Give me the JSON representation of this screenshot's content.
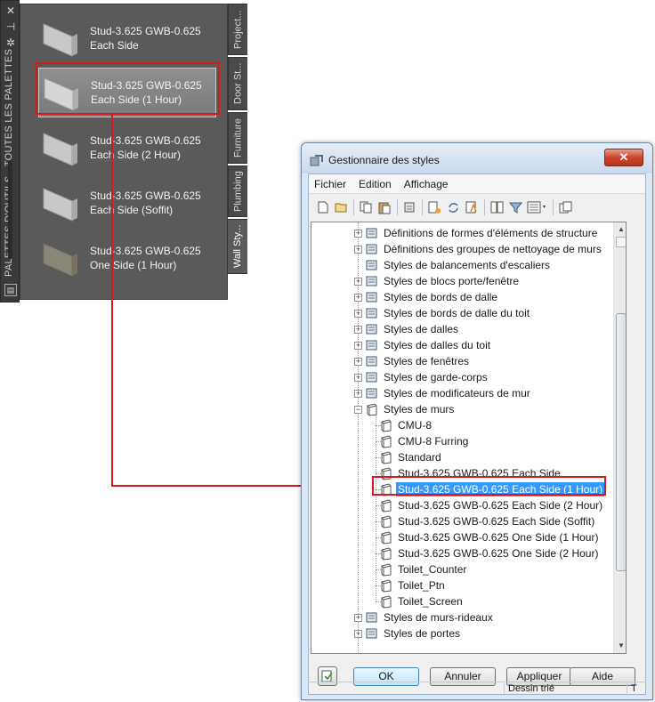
{
  "palette": {
    "vertical_title": "PALETTES D'OUTILS - TOUTES LES PALETTES",
    "tabs": [
      "Project...",
      "Door St...",
      "Furniture",
      "Plumbing",
      "Wall Sty..."
    ],
    "active_tab_index": 4,
    "tools": [
      {
        "label": "Stud-3.625 GWB-0.625\nEach Side"
      },
      {
        "label": "Stud-3.625 GWB-0.625\nEach Side (1 Hour)"
      },
      {
        "label": "Stud-3.625 GWB-0.625\nEach Side (2 Hour)"
      },
      {
        "label": "Stud-3.625 GWB-0.625\nEach Side (Soffit)"
      },
      {
        "label": "Stud-3.625 GWB-0.625\nOne Side (1 Hour)"
      }
    ],
    "selected_tool_index": 1
  },
  "dialog": {
    "title": "Gestionnaire des styles",
    "close_glyph": "✕",
    "menu": [
      "Fichier",
      "Edition",
      "Affichage"
    ],
    "toolbar_icons": [
      "new-icon",
      "open-icon",
      "copy-icon",
      "paste-icon",
      "purge-icon",
      "edit-style-icon",
      "sync-icon",
      "inspect-icon",
      "compare-icon",
      "filter-icon",
      "view-mode-icon",
      "export-icon"
    ],
    "tree": {
      "items": [
        {
          "label": "Définitions de formes d'éléments de structure",
          "level": 0,
          "expander": "+",
          "icon": "structure-shape-icon"
        },
        {
          "label": "Définitions des groupes de nettoyage de murs",
          "level": 0,
          "expander": "+",
          "icon": "cleanup-group-icon"
        },
        {
          "label": "Styles de balancements d'escaliers",
          "level": 0,
          "expander": "",
          "icon": "stair-winder-icon"
        },
        {
          "label": "Styles de blocs porte/fenêtre",
          "level": 0,
          "expander": "+",
          "icon": "door-window-assembly-icon"
        },
        {
          "label": "Styles de bords de dalle",
          "level": 0,
          "expander": "+",
          "icon": "slab-edge-icon"
        },
        {
          "label": "Styles de bords de dalle du toit",
          "level": 0,
          "expander": "+",
          "icon": "roof-slab-edge-icon"
        },
        {
          "label": "Styles de dalles",
          "level": 0,
          "expander": "+",
          "icon": "slab-icon"
        },
        {
          "label": "Styles de dalles du toit",
          "level": 0,
          "expander": "+",
          "icon": "roof-slab-icon"
        },
        {
          "label": "Styles de fenêtres",
          "level": 0,
          "expander": "+",
          "icon": "window-icon"
        },
        {
          "label": "Styles de garde-corps",
          "level": 0,
          "expander": "+",
          "icon": "railing-icon"
        },
        {
          "label": "Styles de modificateurs de mur",
          "level": 0,
          "expander": "+",
          "icon": "wall-modifier-icon"
        },
        {
          "label": "Styles de murs",
          "level": 0,
          "expander": "−",
          "icon": "wall-style-icon"
        },
        {
          "label": "CMU-8",
          "level": 1,
          "expander": "",
          "icon": "wall-style-icon"
        },
        {
          "label": "CMU-8 Furring",
          "level": 1,
          "expander": "",
          "icon": "wall-style-icon"
        },
        {
          "label": "Standard",
          "level": 1,
          "expander": "",
          "icon": "wall-style-icon"
        },
        {
          "label": "Stud-3.625 GWB-0.625 Each Side",
          "level": 1,
          "expander": "",
          "icon": "wall-style-icon"
        },
        {
          "label": "Stud-3.625 GWB-0.625 Each Side (1 Hour)",
          "level": 1,
          "expander": "",
          "icon": "wall-style-icon",
          "selected": true
        },
        {
          "label": "Stud-3.625 GWB-0.625 Each Side (2 Hour)",
          "level": 1,
          "expander": "",
          "icon": "wall-style-icon"
        },
        {
          "label": "Stud-3.625 GWB-0.625 Each Side (Soffit)",
          "level": 1,
          "expander": "",
          "icon": "wall-style-icon"
        },
        {
          "label": "Stud-3.625 GWB-0.625 One Side (1 Hour)",
          "level": 1,
          "expander": "",
          "icon": "wall-style-icon"
        },
        {
          "label": "Stud-3.625 GWB-0.625 One Side (2 Hour)",
          "level": 1,
          "expander": "",
          "icon": "wall-style-icon"
        },
        {
          "label": "Toilet_Counter",
          "level": 1,
          "expander": "",
          "icon": "wall-style-icon"
        },
        {
          "label": "Toilet_Ptn",
          "level": 1,
          "expander": "",
          "icon": "wall-style-icon"
        },
        {
          "label": "Toilet_Screen",
          "level": 1,
          "expander": "",
          "icon": "wall-style-icon"
        },
        {
          "label": "Styles de murs-rideaux",
          "level": 0,
          "expander": "+",
          "icon": "curtain-wall-icon"
        },
        {
          "label": "Styles de portes",
          "level": 0,
          "expander": "+",
          "icon": "door-icon"
        }
      ]
    },
    "buttons": {
      "ok": "OK",
      "cancel": "Annuler",
      "apply": "Appliquer",
      "help": "Aide"
    },
    "status": {
      "left": "",
      "middle": "Dessin trié",
      "right": "T"
    }
  },
  "colors": {
    "highlight_red": "#d9181b",
    "selection_blue": "#3399ff",
    "palette_bg": "#5a5a5a"
  }
}
